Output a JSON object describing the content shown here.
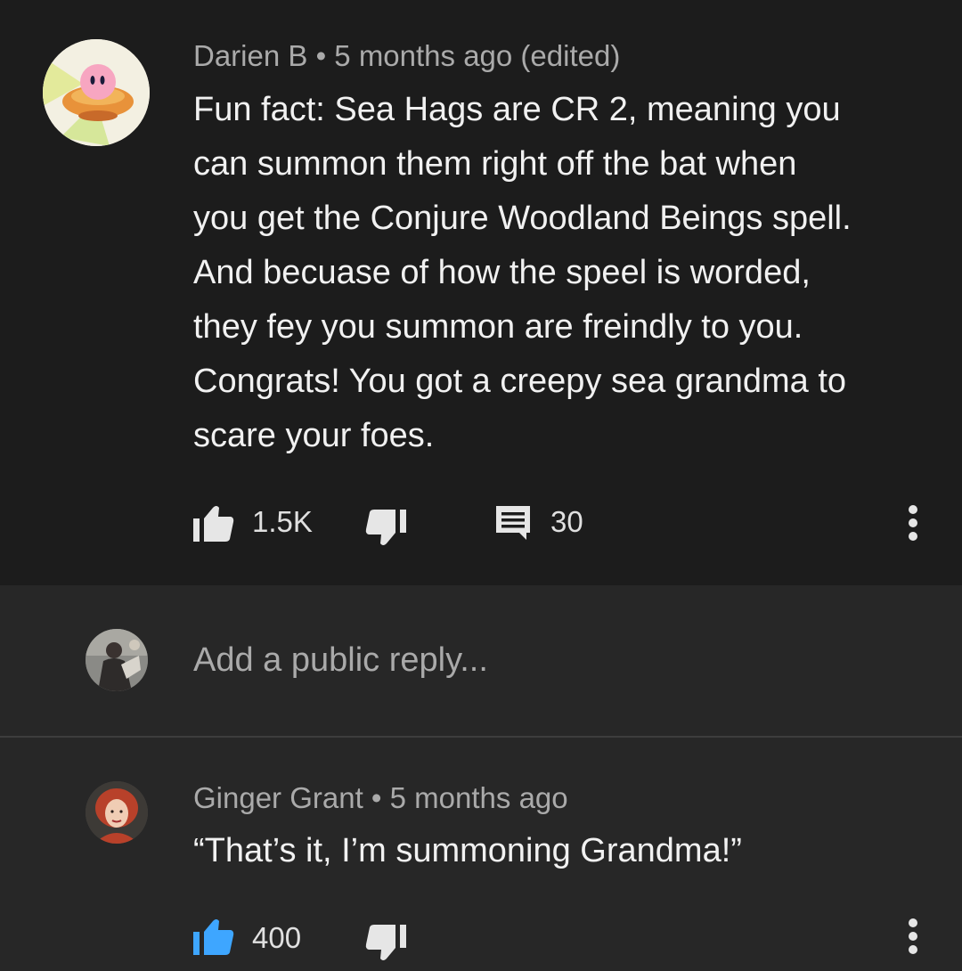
{
  "main_comment": {
    "author": "Darien B",
    "separator": "•",
    "time": "5 months ago (edited)",
    "text": "Fun fact: Sea Hags are CR 2, meaning you\ncan summon them right off the bat when\nyou get the Conjure Woodland Beings spell.\nAnd becuase of how the speel is worded,\nthey fey you summon are freindly to you.\nCongrats! You got a creepy sea grandma to\nscare your foes.",
    "like_count": "1.5K",
    "reply_count": "30",
    "icons": {
      "like": "thumb-up-icon",
      "dislike": "thumb-down-icon",
      "comment": "comment-icon",
      "more": "more-vert-icon"
    }
  },
  "reply_box": {
    "placeholder": "Add a public reply..."
  },
  "reply": {
    "author": "Ginger Grant",
    "separator": "•",
    "time": "5 months ago",
    "text": "“That’s it, I’m summoning Grandma!”",
    "like_count": "400",
    "like_color": "#3ea6ff"
  },
  "colors": {
    "background_main": "#1c1c1c",
    "background_reply": "#272727",
    "text_primary": "#f1f1f1",
    "text_secondary": "#aaaaaa",
    "accent": "#3ea6ff"
  }
}
